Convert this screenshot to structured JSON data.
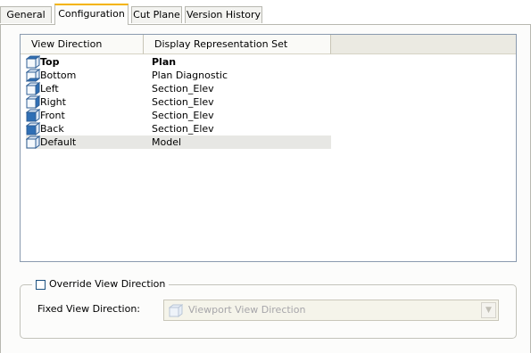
{
  "tabs": [
    {
      "label": "General",
      "active": false
    },
    {
      "label": "Configuration",
      "active": true
    },
    {
      "label": "Cut Plane",
      "active": false
    },
    {
      "label": "Version History",
      "active": false
    }
  ],
  "list": {
    "columns": [
      "View Direction",
      "Display Representation Set"
    ],
    "rows": [
      {
        "view": "Top",
        "rep": "Plan",
        "icon": "cube-top-icon",
        "bold": true
      },
      {
        "view": "Bottom",
        "rep": "Plan Diagnostic",
        "icon": "cube-bottom-icon"
      },
      {
        "view": "Left",
        "rep": "Section_Elev",
        "icon": "cube-left-icon"
      },
      {
        "view": "Right",
        "rep": "Section_Elev",
        "icon": "cube-right-icon"
      },
      {
        "view": "Front",
        "rep": "Section_Elev",
        "icon": "cube-front-icon"
      },
      {
        "view": "Back",
        "rep": "Section_Elev",
        "icon": "cube-back-icon"
      },
      {
        "view": "Default",
        "rep": "Model",
        "icon": "cube-default-icon",
        "selected": true
      }
    ]
  },
  "override": {
    "label": "Override View Direction",
    "checked": false
  },
  "fixed_direction": {
    "label": "Fixed View Direction:",
    "value": "Viewport View Direction",
    "enabled": false
  },
  "colors": {
    "active_tab_accent": "#f4b400",
    "cube_blue": "#2f6fb5",
    "disabled_text": "#a7a6aa"
  }
}
